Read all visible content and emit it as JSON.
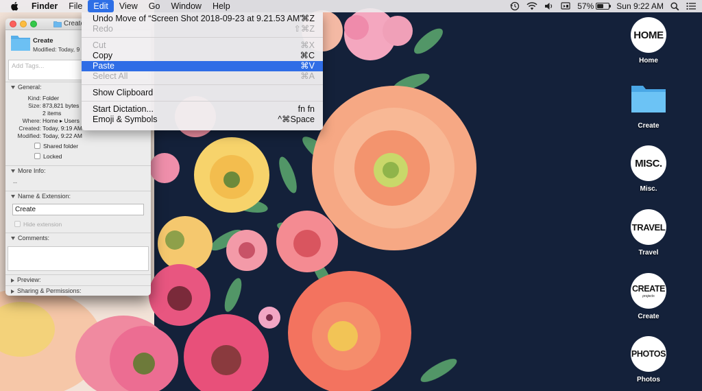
{
  "menubar": {
    "app_name": "Finder",
    "menus": [
      "File",
      "Edit",
      "View",
      "Go",
      "Window",
      "Help"
    ],
    "active_menu": "Edit",
    "battery_percent": "57%",
    "battery_level": 0.57,
    "clock": "Sun 9:22 AM",
    "status_icons": [
      "time-machine-icon",
      "wifi-icon",
      "volume-icon",
      "display-icon",
      "battery-icon",
      "spotlight-search-icon",
      "notification-center-icon"
    ]
  },
  "edit_menu": {
    "undo": {
      "label": "Undo Move of “Screen Shot 2018-09-23 at 9.21.53 AM”",
      "shortcut": "⌘Z"
    },
    "redo": {
      "label": "Redo",
      "shortcut": "⇧⌘Z"
    },
    "cut": {
      "label": "Cut",
      "shortcut": "⌘X"
    },
    "copy": {
      "label": "Copy",
      "shortcut": "⌘C"
    },
    "paste": {
      "label": "Paste",
      "shortcut": "⌘V"
    },
    "select_all": {
      "label": "Select All",
      "shortcut": "⌘A"
    },
    "show_clipboard": {
      "label": "Show Clipboard"
    },
    "start_dictation": {
      "label": "Start Dictation...",
      "shortcut": "fn fn"
    },
    "emoji_symbols": {
      "label": "Emoji & Symbols",
      "shortcut": "^⌘Space"
    }
  },
  "info_window": {
    "title": "Create",
    "name": "Create",
    "modified_summary": "Modified: Today, 9",
    "tags_placeholder": "Add Tags...",
    "general": {
      "header": "General:",
      "kind_label": "Kind:",
      "kind": "Folder",
      "size_label": "Size:",
      "size": "873,821 bytes",
      "items": "2 items",
      "where_label": "Where:",
      "where": "Home ▸ Users",
      "created_label": "Created:",
      "created": "Today, 9:19 AM",
      "modified_label": "Modified:",
      "modified": "Today, 9:22 AM",
      "shared_folder": "Shared folder",
      "locked": "Locked"
    },
    "more_info": {
      "header": "More Info:",
      "value": "--"
    },
    "name_extension": {
      "header": "Name & Extension:",
      "value": "Create",
      "hide_extension": "Hide extension"
    },
    "comments": {
      "header": "Comments:"
    },
    "preview": {
      "header": "Preview:"
    },
    "sharing": {
      "header": "Sharing & Permissions:"
    }
  },
  "desktop_icons": [
    {
      "badge": "HOME",
      "label": "Home"
    },
    {
      "label": "Create"
    },
    {
      "badge": "MISC.",
      "label": "Misc."
    },
    {
      "badge": "TRAVEL",
      "label": "Travel"
    },
    {
      "badge": "CREATE",
      "badge_sub": "projects",
      "label": "Create"
    },
    {
      "badge": "PHOTOS",
      "label": "Photos"
    }
  ],
  "colors": {
    "wallpaper_navy": "#14213a",
    "menu_highlight": "#2f6de6",
    "folder_blue": "#5fb6ef"
  }
}
